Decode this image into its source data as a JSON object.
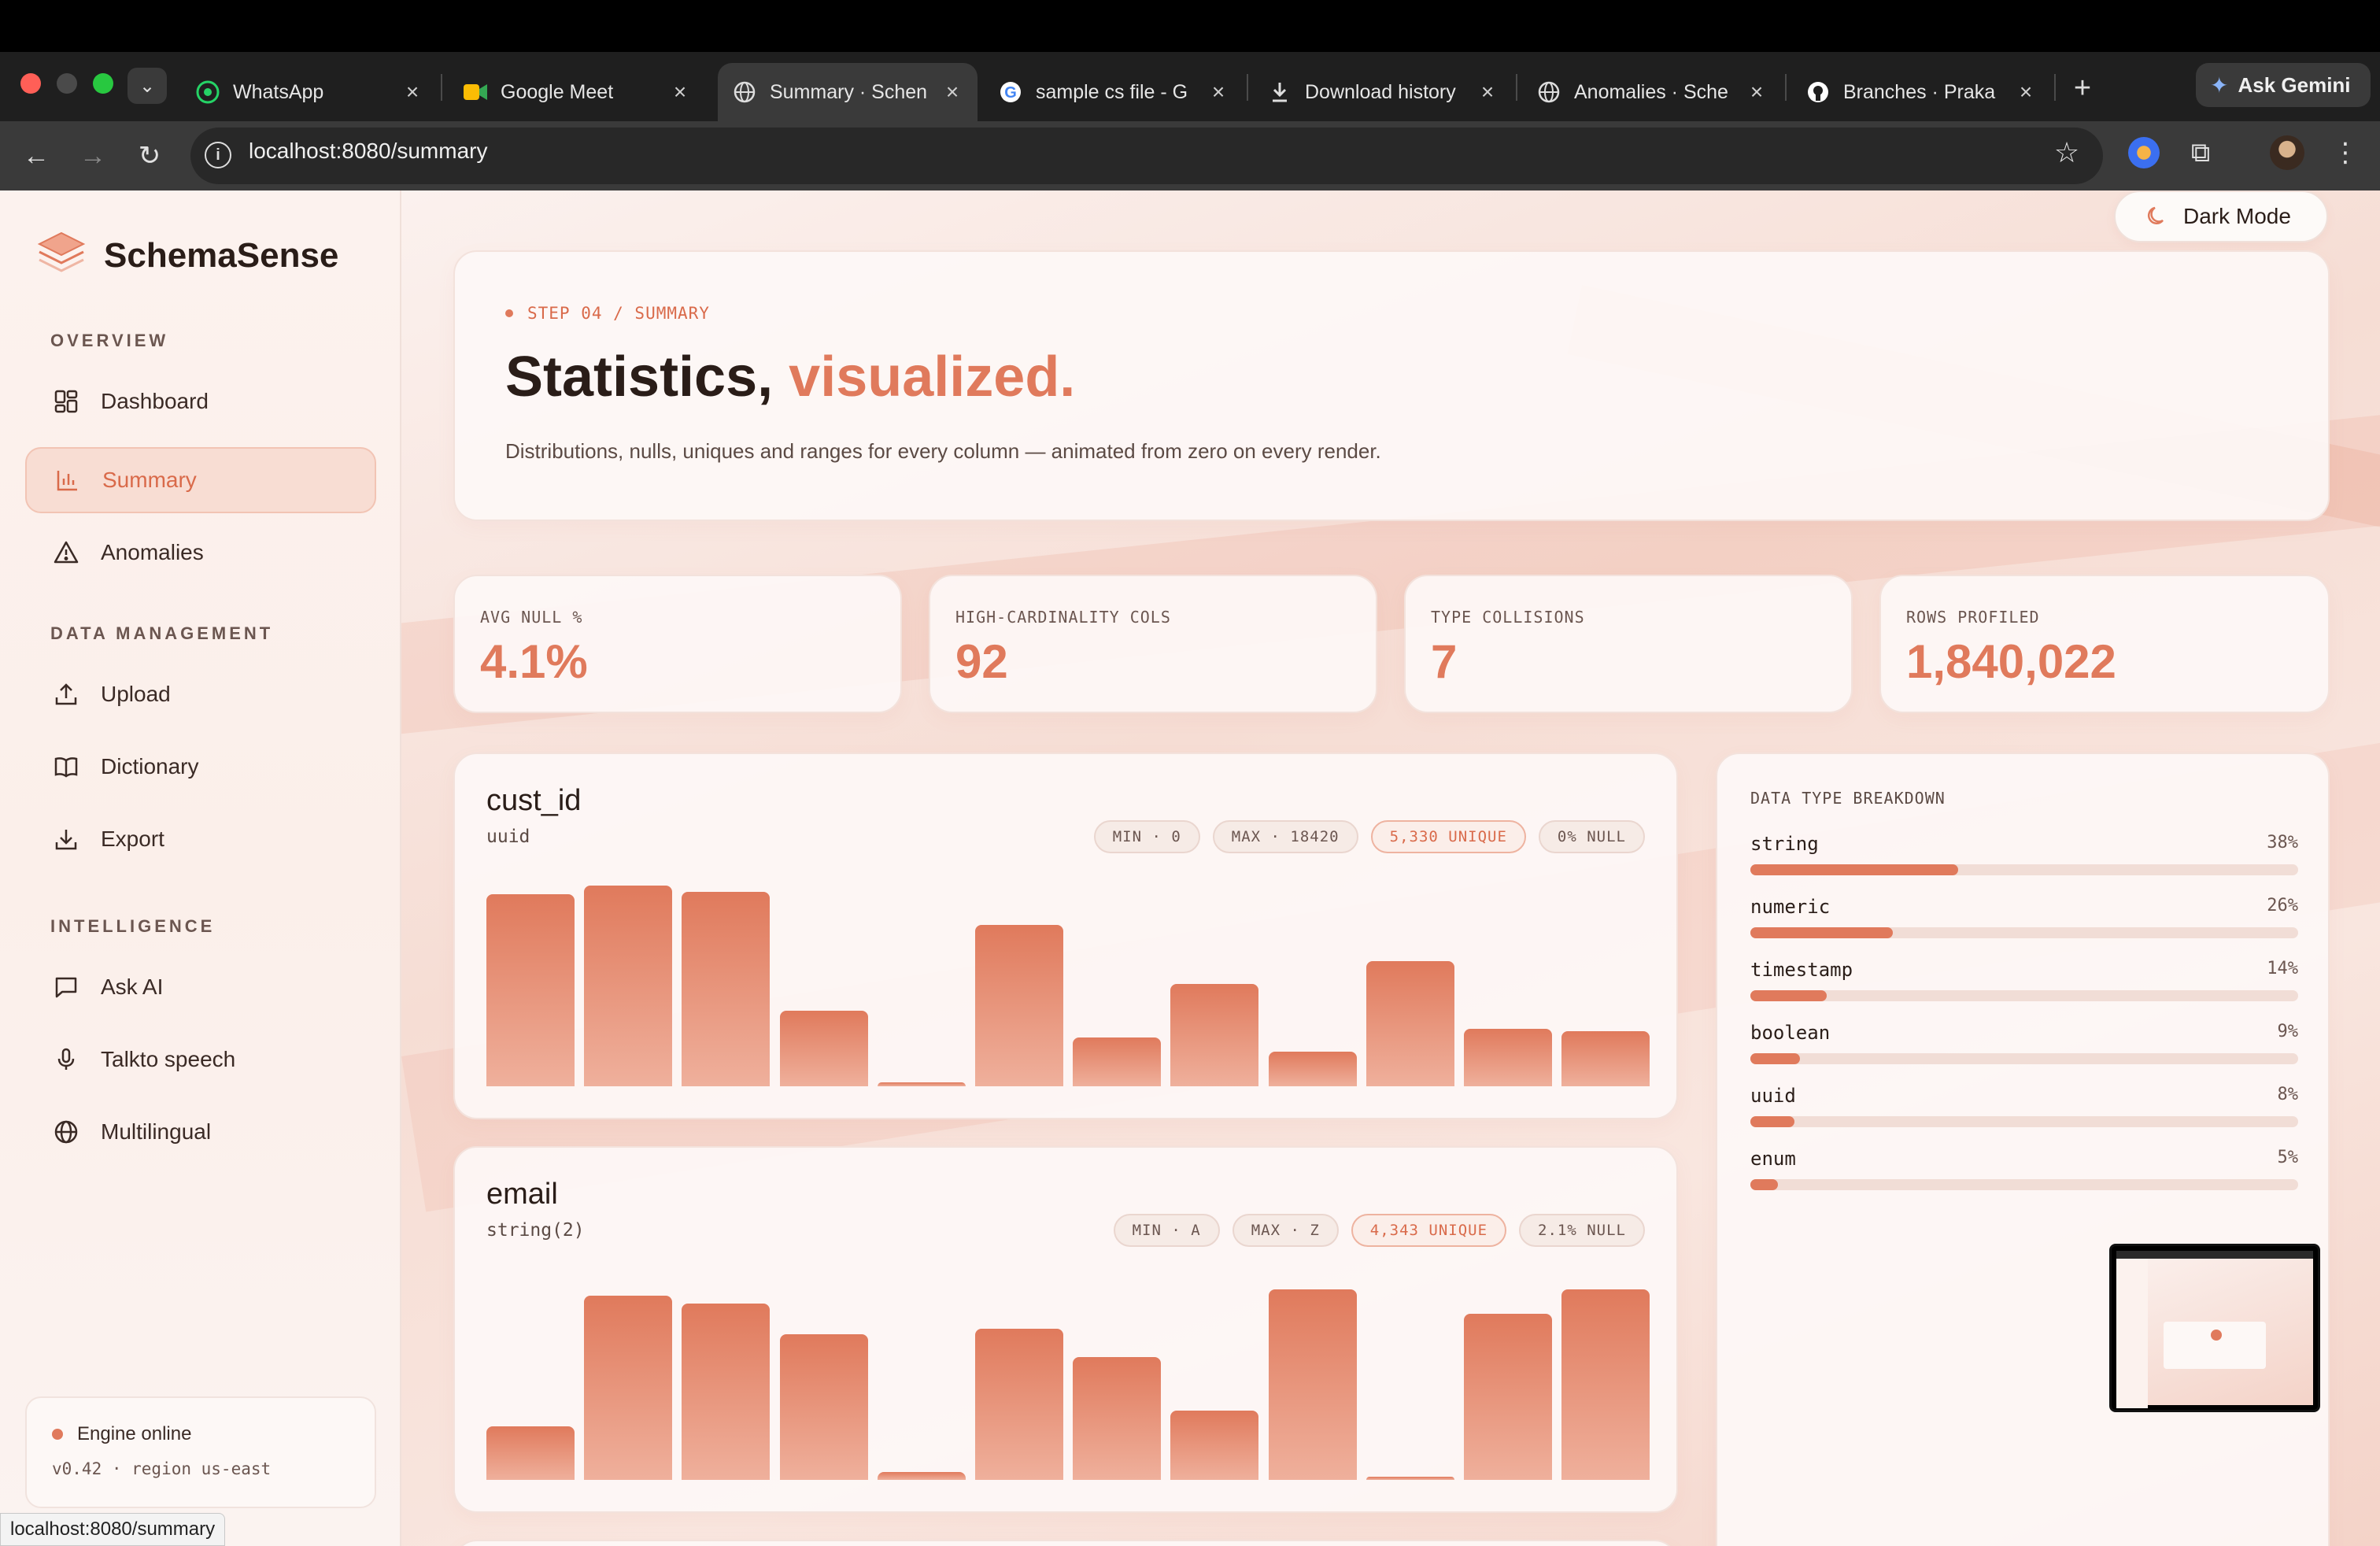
{
  "browser": {
    "tabs": [
      {
        "label": "WhatsApp",
        "icon": "whatsapp-icon"
      },
      {
        "label": "Google Meet",
        "icon": "google-meet-icon"
      },
      {
        "label": "Summary · Schen",
        "icon": "globe-icon",
        "active": true
      },
      {
        "label": "sample cs file - G",
        "icon": "google-icon"
      },
      {
        "label": "Download history",
        "icon": "download-icon"
      },
      {
        "label": "Anomalies · Sche",
        "icon": "globe-icon"
      },
      {
        "label": "Branches · Praka",
        "icon": "github-icon"
      }
    ],
    "ask_gemini": "Ask Gemini",
    "url": "localhost:8080/summary",
    "status_url": "localhost:8080/summary"
  },
  "app": {
    "brand": "SchemaSense",
    "dark_mode_label": "Dark Mode",
    "sidebar": {
      "overview_label": "OVERVIEW",
      "data_management_label": "DATA MANAGEMENT",
      "intelligence_label": "INTELLIGENCE",
      "items": [
        {
          "label": "Dashboard"
        },
        {
          "label": "Summary"
        },
        {
          "label": "Anomalies"
        },
        {
          "label": "Upload"
        },
        {
          "label": "Dictionary"
        },
        {
          "label": "Export"
        },
        {
          "label": "Ask AI"
        },
        {
          "label": "Talkto speech"
        },
        {
          "label": "Multilingual"
        }
      ],
      "active_item": "Summary",
      "engine_status": "Engine online",
      "engine_version": "v0.42 · region us-east"
    },
    "hero": {
      "step": "STEP 04 / SUMMARY",
      "title_main": "Statistics,",
      "title_accent": "visualized.",
      "subtitle": "Distributions, nulls, uniques and ranges for every column — animated from zero on every render."
    },
    "stats": [
      {
        "label": "AVG NULL %",
        "value": "4.1%"
      },
      {
        "label": "HIGH-CARDINALITY COLS",
        "value": "92"
      },
      {
        "label": "TYPE COLLISIONS",
        "value": "7"
      },
      {
        "label": "ROWS PROFILED",
        "value": "1,840,022"
      }
    ],
    "columns": [
      {
        "name": "cust_id",
        "type": "uuid",
        "min": "MIN · 0",
        "max": "MAX · 18420",
        "unique": "5,330 UNIQUE",
        "null": "0% NULL",
        "distribution": [
          0.94,
          0.98,
          0.95,
          0.37,
          0.02,
          0.79,
          0.24,
          0.5,
          0.17,
          0.61,
          0.28,
          0.27
        ]
      },
      {
        "name": "email",
        "type": "string(2)",
        "min": "MIN · A",
        "max": "MAX · Z",
        "unique": "4,343 UNIQUE",
        "null": "2.1% NULL",
        "distribution": [
          0.26,
          0.9,
          0.86,
          0.71,
          0.04,
          0.74,
          0.6,
          0.34,
          0.93,
          0.01,
          0.81,
          0.93
        ]
      }
    ],
    "data_type_breakdown": {
      "title": "DATA TYPE BREAKDOWN",
      "items": [
        {
          "name": "string",
          "pct_label": "38%",
          "pct": 38
        },
        {
          "name": "numeric",
          "pct_label": "26%",
          "pct": 26
        },
        {
          "name": "timestamp",
          "pct_label": "14%",
          "pct": 14
        },
        {
          "name": "boolean",
          "pct_label": "9%",
          "pct": 9
        },
        {
          "name": "uuid",
          "pct_label": "8%",
          "pct": 8
        },
        {
          "name": "enum",
          "pct_label": "5%",
          "pct": 5
        }
      ]
    },
    "colors": {
      "accent": "#e07a5c",
      "active_bg": "#f8ddd3",
      "engine_dot": "#e07a5c"
    }
  }
}
